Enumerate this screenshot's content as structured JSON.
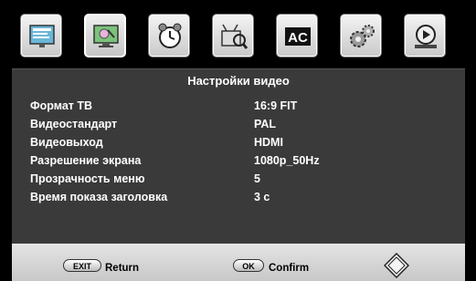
{
  "tabs": [
    {
      "name": "picture-menu-icon",
      "active": false
    },
    {
      "name": "display-menu-icon",
      "active": true
    },
    {
      "name": "timer-menu-icon",
      "active": false
    },
    {
      "name": "channel-search-menu-icon",
      "active": false
    },
    {
      "name": "subtitle-menu-icon",
      "active": false
    },
    {
      "name": "system-settings-menu-icon",
      "active": false
    },
    {
      "name": "media-menu-icon",
      "active": false
    }
  ],
  "panel": {
    "title": "Настройки видео",
    "rows": [
      {
        "label": "Формат ТВ",
        "value": "16:9 FIT"
      },
      {
        "label": "Видеостандарт",
        "value": "PAL"
      },
      {
        "label": "Видеовыход",
        "value": "HDMI"
      },
      {
        "label": "Разрешение экрана",
        "value": "1080p_50Hz"
      },
      {
        "label": "Прозрачность меню",
        "value": "5"
      },
      {
        "label": "Время показа заголовка",
        "value": "3 с"
      }
    ]
  },
  "footer": {
    "exit_key": "EXIT",
    "exit_label": "Return",
    "ok_key": "OK",
    "ok_label": "Confirm"
  },
  "icons": {
    "navigation": "dpad-navigation-icon"
  }
}
